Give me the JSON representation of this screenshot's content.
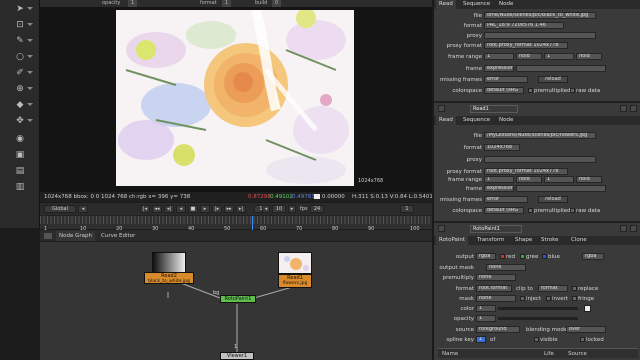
{
  "topbar": {
    "opacity_label": "opacity",
    "opacity_value": "1",
    "format_label": "format",
    "format_value": "1",
    "build_label": "build",
    "build_value": "0"
  },
  "viewer": {
    "resolution_label": "1024x768"
  },
  "infobar": {
    "bbox": "1024x768 bbox: 0 0 1024 768 ch:rgb x= 396 y= 738",
    "r": "0.87298",
    "g": "0.49102",
    "b": "0.49783",
    "a": "0.00000",
    "hsvl": "H:311 S:0.13 V:0.84 L:0.54014"
  },
  "transport": {
    "global": "Global",
    "fps_label": "fps",
    "fps_value": "24",
    "frame": "1",
    "step": "10",
    "end": "1"
  },
  "timeline": {
    "ticks": [
      "1",
      "10",
      "20",
      "30",
      "40",
      "50",
      "60",
      "70",
      "80",
      "90",
      "100"
    ],
    "start": "1",
    "end": "100"
  },
  "node_graph": {
    "tabs": [
      "Node Graph",
      "Curve Editor"
    ],
    "nodes": {
      "read2_title": "Read2",
      "read2_file": "black_to_white.jpg",
      "read1_title": "Read1",
      "read1_file": "flowers.jpg",
      "roto_title": "RotoPaint1",
      "viewer_title": "Viewer1",
      "bg_label": "bg",
      "input_label": "1"
    }
  },
  "read2_panel": {
    "tabs": [
      "Read",
      "Sequence",
      "Node"
    ],
    "file_label": "file",
    "file_value": "ome/Nuke/scenes/pic/black_to_white.jpg",
    "format_label": "format",
    "format_value": "PAL_16:9 720x576 1.46",
    "proxy_label": "proxy",
    "proxy_format_label": "proxy format",
    "proxy_format_value": "root.proxy_format 1024x778",
    "frame_range_label": "frame range",
    "frame_range_start": "1",
    "hold_label": "hold",
    "frame_range_end": "1",
    "hold2_label": "hold",
    "frame_label": "frame",
    "frame_value": "expression",
    "missing_frames_label": "missing frames",
    "missing_frames_value": "error",
    "reload_label": "reload",
    "colorspace_label": "colorspace",
    "colorspace_value": "default (sRG",
    "premultiplied_label": "premultiplied",
    "raw_data_label": "raw data"
  },
  "read1_panel": {
    "node_name": "Read1",
    "tabs": [
      "Read",
      "Sequence",
      "Node"
    ],
    "file_label": "file",
    "file_value": "/MyLessons/Nuke/scenes/pic/flowers.jpg",
    "format_label": "format",
    "format_value": "1024x768",
    "proxy_label": "proxy",
    "proxy_format_label": "proxy format",
    "proxy_format_value": "root.proxy_format 1024x778",
    "frame_range_label": "frame range",
    "frame_range_start": "1",
    "hold_label": "hold",
    "frame_range_end": "1",
    "hold2_label": "hold",
    "frame_label": "frame",
    "frame_value": "expression",
    "missing_frames_label": "missing frames",
    "missing_frames_value": "error",
    "reload_label": "reload",
    "colorspace_label": "colorspace",
    "colorspace_value": "default (sRG",
    "premultiplied_label": "premultiplied",
    "raw_data_label": "raw data"
  },
  "roto_panel": {
    "node_name": "RotoPaint1",
    "tabs": [
      "RotoPaint",
      "Transform",
      "Shape",
      "Stroke",
      "Clone"
    ],
    "output_label": "output",
    "output_value": "rgba",
    "red_label": "red",
    "green_label": "gree",
    "blue_label": "blue",
    "rgba_value": "rgba",
    "output_mask_label": "output mask",
    "output_mask_value": "none",
    "premultiply_label": "premultiply",
    "premultiply_value": "none",
    "clip_to_label": "clip to",
    "clip_to_value": "format",
    "replace_label": "replace",
    "format_label": "format",
    "format_value": "root.format",
    "mask_label": "mask",
    "mask_value": "none",
    "inject_label": "inject",
    "invert_label": "invert",
    "fringe_label": "fringe",
    "color_label": "color",
    "color_value": "1",
    "opacity_label": "opacity",
    "opacity_value": "1",
    "source_label": "source",
    "source_value": "foreground",
    "blending_label": "blending mode",
    "blending_value": "over",
    "spline_key_label": "spline key",
    "spline_key_value": "1",
    "of_label": "of",
    "visible_label": "visible",
    "locked_label": "locked",
    "name_col": "Name",
    "life_col": "Life",
    "source_col": "Source"
  },
  "colors": {
    "roto_node": "#5fbf4a",
    "read_node": "#d98b2b",
    "accent": "#e0a050",
    "red_dot": "#d03030",
    "green_dot": "#30b030",
    "blue_dot": "#3050d0"
  }
}
